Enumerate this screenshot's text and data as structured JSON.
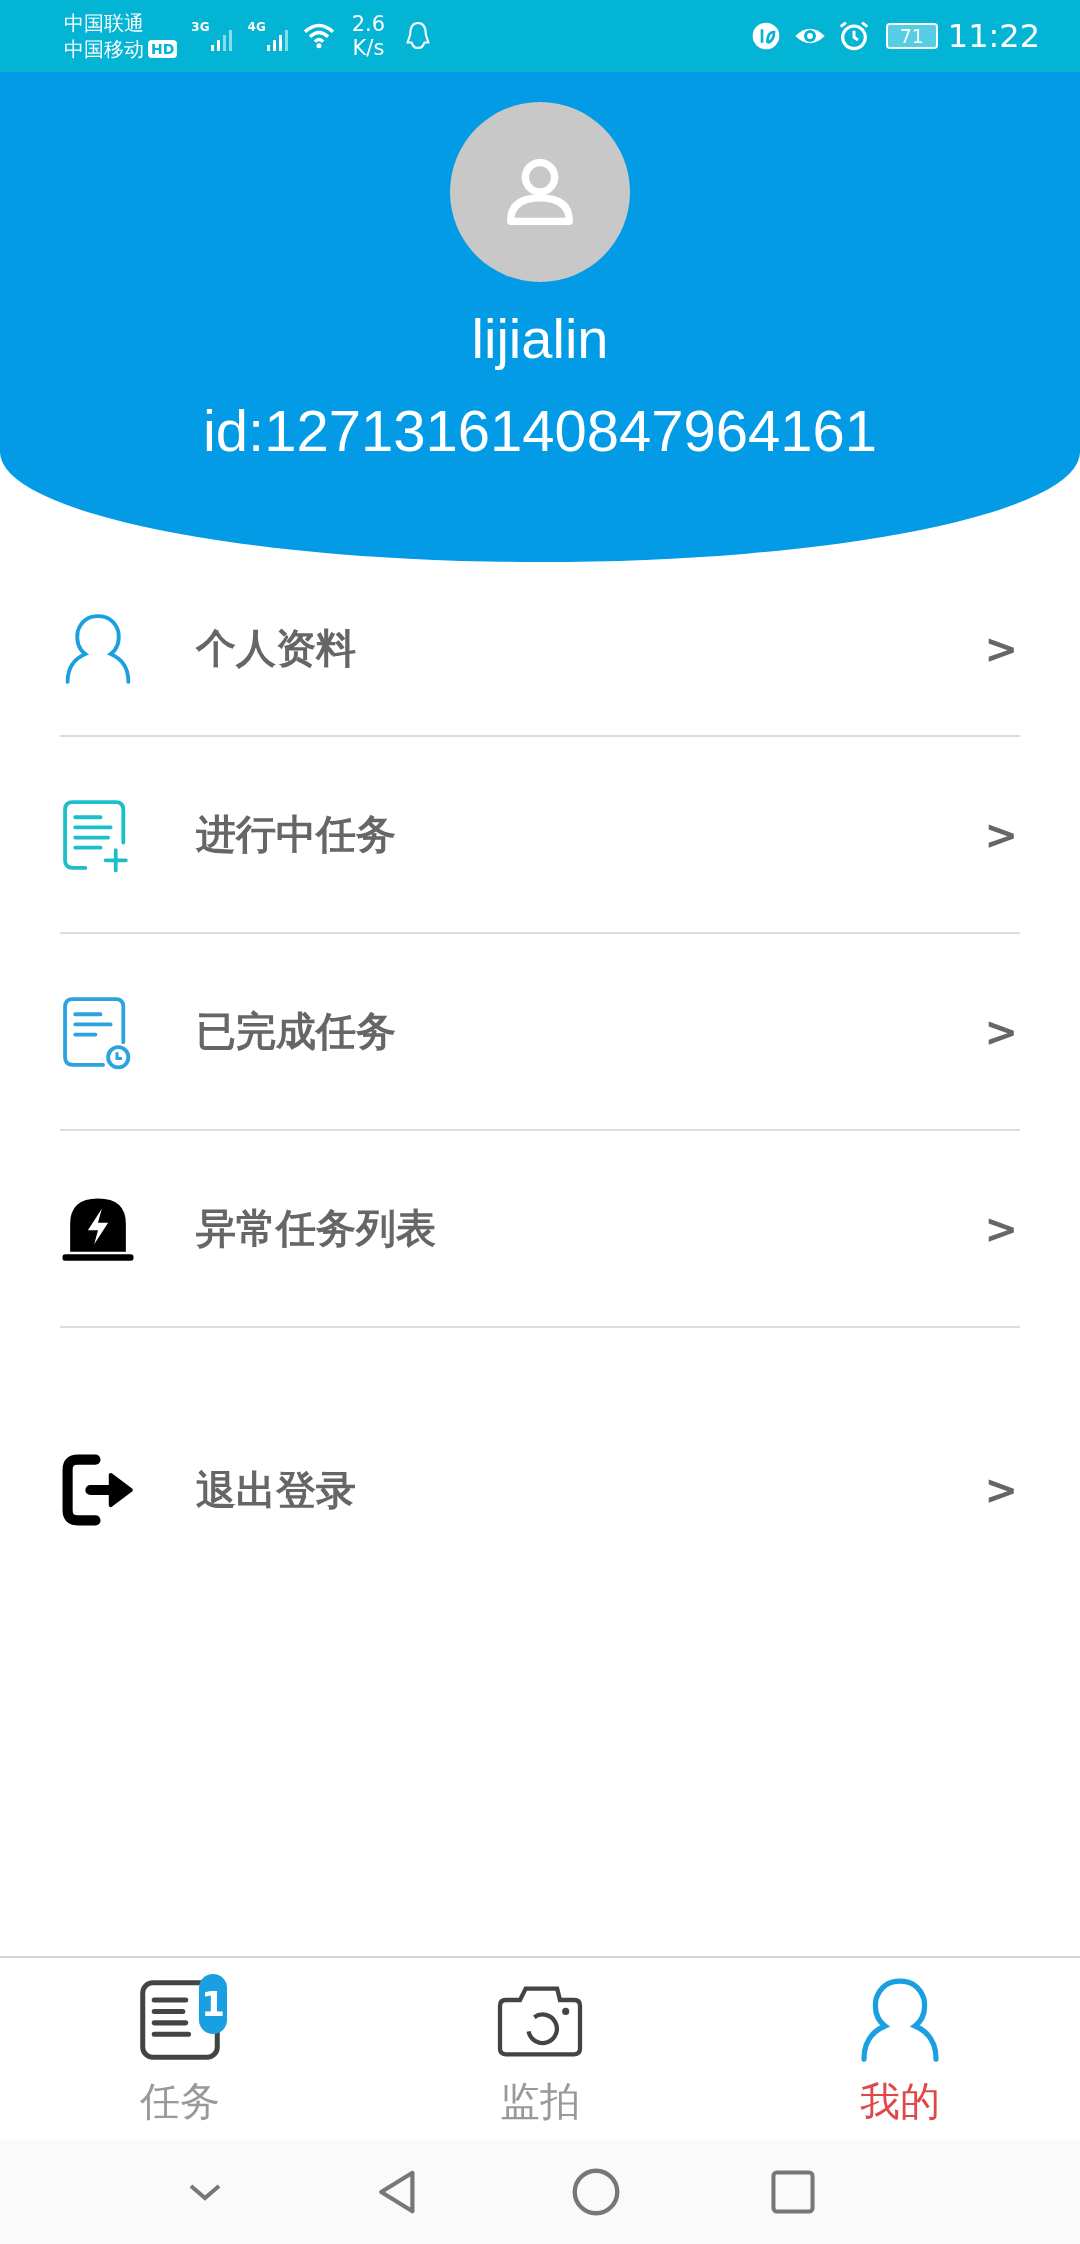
{
  "status_bar": {
    "carrier_1": "中国联通",
    "carrier_2": "中国移动",
    "hd": "HD",
    "signal_1": "3G",
    "signal_2": "4G",
    "speed": "2.6",
    "speed_unit": "K/s",
    "battery": "71",
    "time": "11:22"
  },
  "profile": {
    "username": "lijialin",
    "id": "id:1271316140847964161"
  },
  "menu": [
    {
      "label": "个人资料",
      "kind": "profile",
      "chevron": ">"
    },
    {
      "label": "进行中任务",
      "kind": "in-progress",
      "chevron": ">"
    },
    {
      "label": "已完成任务",
      "kind": "completed",
      "chevron": ">"
    },
    {
      "label": "异常任务列表",
      "kind": "alarm",
      "chevron": ">"
    }
  ],
  "logout": {
    "label": "退出登录",
    "chevron": ">"
  },
  "tabs": [
    {
      "label": "任务",
      "kind": "tasks",
      "badge": "1",
      "selected": false
    },
    {
      "label": "监拍",
      "kind": "camera",
      "selected": false
    },
    {
      "label": "我的",
      "kind": "me",
      "selected": true
    }
  ]
}
